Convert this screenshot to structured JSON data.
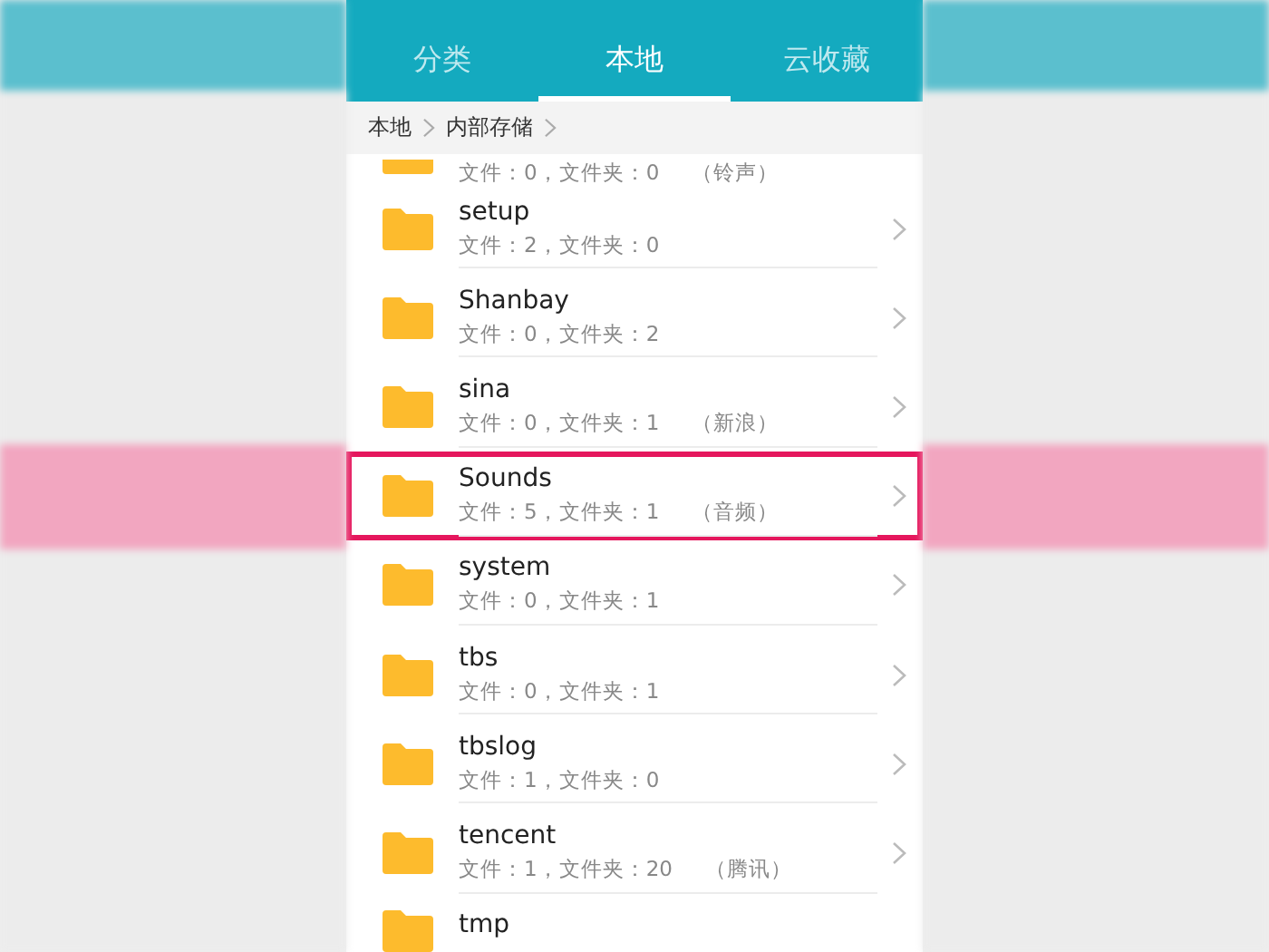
{
  "tabs": [
    {
      "label": "分类",
      "selected": false
    },
    {
      "label": "本地",
      "selected": true
    },
    {
      "label": "云收藏",
      "selected": false
    }
  ],
  "breadcrumb": [
    "本地",
    "内部存储"
  ],
  "folders": [
    {
      "kind": "cut-top",
      "info": "文件：0，文件夹：0",
      "tag": "（铃声）",
      "highlighted": false
    },
    {
      "kind": "full",
      "name": "setup",
      "info": "文件：2，文件夹：0",
      "highlighted": false
    },
    {
      "kind": "full",
      "name": "Shanbay",
      "info": "文件：0，文件夹：2",
      "highlighted": false
    },
    {
      "kind": "full",
      "name": "sina",
      "info": "文件：0，文件夹：1",
      "tag": "（新浪）",
      "highlighted": false
    },
    {
      "kind": "full",
      "name": "Sounds",
      "info": "文件：5，文件夹：1",
      "tag": "（音频）",
      "highlighted": true
    },
    {
      "kind": "full",
      "name": "system",
      "info": "文件：0，文件夹：1",
      "highlighted": false
    },
    {
      "kind": "full",
      "name": "tbs",
      "info": "文件：0，文件夹：1",
      "highlighted": false
    },
    {
      "kind": "full",
      "name": "tbslog",
      "info": "文件：1，文件夹：0",
      "highlighted": false
    },
    {
      "kind": "full",
      "name": "tencent",
      "info": "文件：1，文件夹：20",
      "tag": "（腾讯）",
      "highlighted": false
    },
    {
      "kind": "cut-bottom",
      "name": "tmp",
      "highlighted": false
    }
  ]
}
